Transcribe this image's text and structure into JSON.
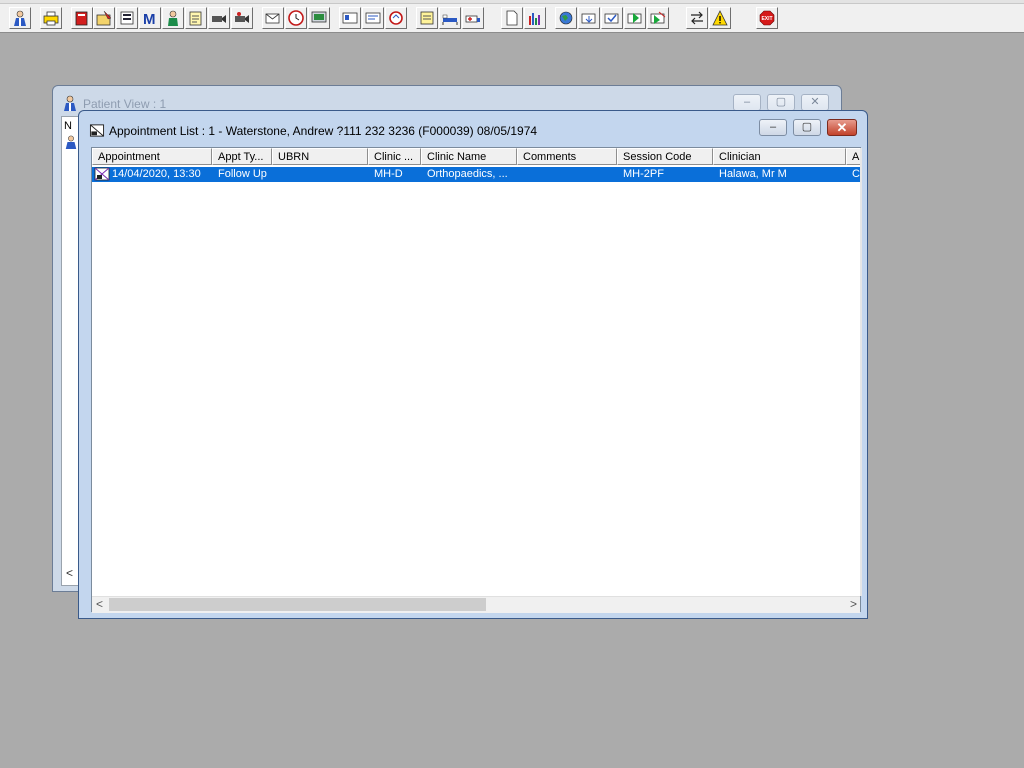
{
  "toolbar": {
    "buttons": [
      "patient-icon",
      "printer-icon",
      "book-icon",
      "folder-edit-icon",
      "screen-list-icon",
      "letter-m-icon",
      "doctor-icon",
      "notepad-icon",
      "camera-icon",
      "camera-alt-icon",
      "envelope-edit-icon",
      "clock-icon",
      "monitor-icon",
      "card-icon",
      "form-icon",
      "refresh-icon",
      "note-icon",
      "bed-icon",
      "ambulance-icon",
      "document-icon",
      "bar-chart-icon",
      "globe-icon",
      "mail-down-icon",
      "mail-check-icon",
      "mail-green-icon",
      "mail-green-alt-icon",
      "transfer-icon",
      "warning-icon",
      "exit-icon"
    ],
    "exit_label": "EXIT"
  },
  "patient_view": {
    "title": "Patient View : 1",
    "inner_label": "N",
    "scroll_left": "<"
  },
  "appt_window": {
    "title": "Appointment List : 1 - Waterstone, Andrew ?111 232 3236 (F000039) 08/05/1974",
    "columns": [
      "Appointment",
      "Appt Ty...",
      "UBRN",
      "Clinic ...",
      "Clinic Name",
      "Comments",
      "Session Code",
      "Clinician",
      "A"
    ],
    "rows": [
      {
        "appointment": "14/04/2020, 13:30",
        "appt_type": "Follow Up",
        "ubrn": "",
        "clinic": "MH-D",
        "clinic_name": "Orthopaedics, ...",
        "comments": "",
        "session_code": "MH-2PF",
        "clinician": "Halawa, Mr M",
        "a": "C"
      }
    ],
    "scroll_left": "<",
    "scroll_right": ">"
  },
  "window_controls": {
    "minimize": "–",
    "maximize": "▢",
    "close": "✕"
  },
  "colors": {
    "desktop": "#ababab",
    "selection": "#0a6fd9",
    "close_button": "#c2422a"
  }
}
